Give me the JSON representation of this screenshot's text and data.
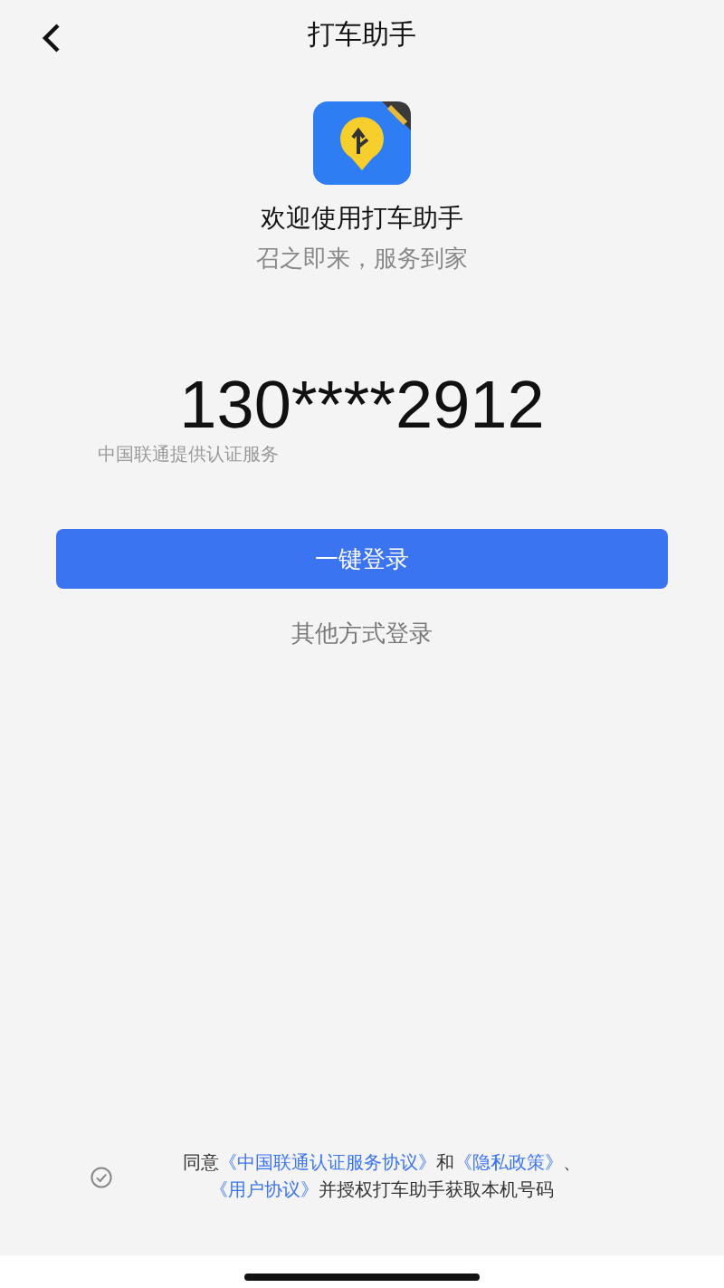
{
  "header": {
    "title": "打车助手"
  },
  "app": {
    "welcome": "欢迎使用打车助手",
    "slogan": "召之即来，服务到家"
  },
  "phone": {
    "number": "130****2912",
    "provider": "中国联通提供认证服务"
  },
  "login_button": "一键登录",
  "other_login": "其他方式登录",
  "agreement": {
    "checked": false,
    "parts": [
      {
        "kind": "text",
        "text": "同意"
      },
      {
        "kind": "link",
        "text": "《中国联通认证服务协议》"
      },
      {
        "kind": "text",
        "text": "和"
      },
      {
        "kind": "link",
        "text": "《隐私政策》"
      },
      {
        "kind": "text",
        "text": "、"
      },
      {
        "kind": "link",
        "text": "《用户协议》"
      },
      {
        "kind": "text",
        "text": "并授权打车助手获取本机号码"
      }
    ]
  }
}
